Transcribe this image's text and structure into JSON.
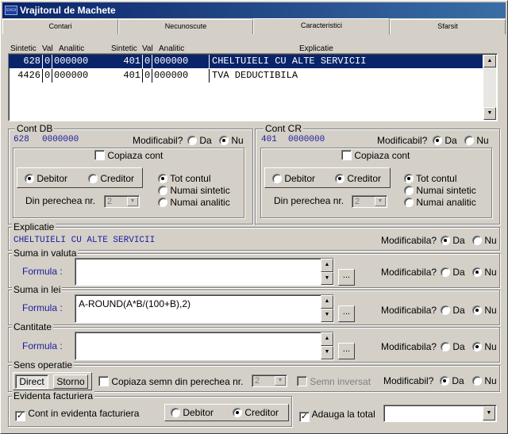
{
  "window": {
    "title": "Vrajitorul de Machete",
    "icon": "app-icon"
  },
  "tabs": [
    {
      "label": "Contari"
    },
    {
      "label": "Necunoscute"
    },
    {
      "label": "Caracteristici"
    },
    {
      "label": "Sfarsit"
    }
  ],
  "grid": {
    "headers": {
      "sintetic1": "Sintetic",
      "val1": "Val",
      "analitic1": "Analitic",
      "sintetic2": "Sintetic",
      "val2": "Val",
      "analitic2": "Analitic",
      "explicatie": "Explicatie"
    },
    "rows": [
      {
        "s1": "628",
        "v1": "0",
        "a1": "000000",
        "s2": "401",
        "v2": "0",
        "a2": "000000",
        "exp": "CHELTUIELI CU ALTE SERVICII"
      },
      {
        "s1": "4426",
        "v1": "0",
        "a1": "000000",
        "s2": "401",
        "v2": "0",
        "a2": "000000",
        "exp": "TVA DEDUCTIBILA"
      }
    ]
  },
  "common": {
    "modificabil": "Modificabil?",
    "modificabila": "Modificabila?",
    "da": "Da",
    "nu": "Nu",
    "formula": "Formula :",
    "dots": "...",
    "copiaza_cont": "Copiaza cont",
    "debitor": "Debitor",
    "creditor": "Creditor",
    "tot_contul": "Tot contul",
    "numai_sintetic": "Numai sintetic",
    "numai_analitic": "Numai analitic",
    "din_perechea": "Din perechea nr.",
    "pereche_val": "2"
  },
  "cont_db": {
    "label": "Cont DB",
    "cont": "628",
    "analitic": "0000000"
  },
  "cont_cr": {
    "label": "Cont CR",
    "cont": "401",
    "analitic": "0000000"
  },
  "explicatie": {
    "label": "Explicatie",
    "value": "CHELTUIELI CU ALTE SERVICII"
  },
  "suma_valuta": {
    "label": "Suma in valuta",
    "formula": ""
  },
  "suma_lei": {
    "label": "Suma in lei",
    "formula": "A-ROUND(A*B/(100+B),2)"
  },
  "cantitate": {
    "label": "Cantitate",
    "formula": ""
  },
  "sens": {
    "label": "Sens operatie",
    "direct": "Direct",
    "storno": "Storno",
    "copiaza_semn": "Copiaza semn din perechea nr.",
    "pereche": "2",
    "semn_inversat": "Semn inversat"
  },
  "evidenta": {
    "label": "Evidenta facturiera",
    "cont_in": "Cont in evidenta facturiera",
    "debitor": "Debitor",
    "creditor": "Creditor",
    "adauga": "Adauga la total",
    "combo_value": ""
  },
  "colors": {
    "title_start": "#0a246a",
    "title_end": "#3a6ea5",
    "selection": "#0a246a",
    "account_text": "#1c1c9c"
  }
}
